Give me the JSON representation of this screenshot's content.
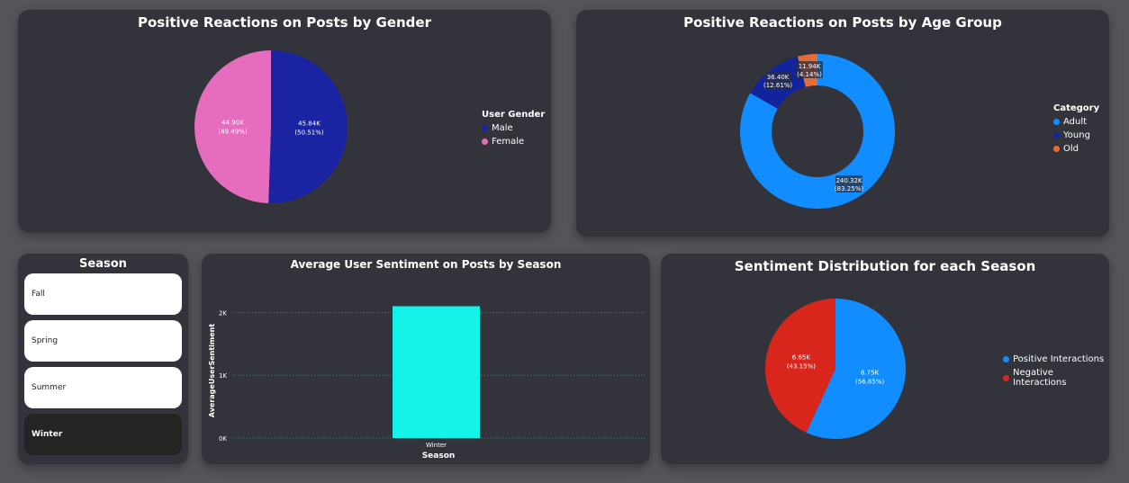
{
  "gender_card": {
    "title": "Positive Reactions on Posts by Gender",
    "legend_title": "User Gender"
  },
  "age_card": {
    "title": "Positive Reactions on Posts by Age Group",
    "legend_title": "Category"
  },
  "season_slicer": {
    "title": "Season",
    "items": [
      "Fall",
      "Spring",
      "Summer",
      "Winter"
    ],
    "selected": "Winter"
  },
  "bar_card": {
    "title": "Average User Sentiment on Posts by Season"
  },
  "season_pie_card": {
    "title": "Sentiment Distribution for each Season"
  },
  "chart_data": [
    {
      "type": "pie",
      "title": "Positive Reactions on Posts by Gender",
      "legend_title": "User Gender",
      "slices": [
        {
          "name": "Male",
          "value": 45.84,
          "unit": "K",
          "label": "45.84K",
          "pct_label": "(50.51%)",
          "color": "#1a24a3"
        },
        {
          "name": "Female",
          "value": 44.9,
          "unit": "K",
          "label": "44.90K",
          "pct_label": "(49.49%)",
          "color": "#e66cbd"
        }
      ]
    },
    {
      "type": "donut",
      "title": "Positive Reactions on Posts by Age Group",
      "legend_title": "Category",
      "slices": [
        {
          "name": "Adult",
          "value": 240.32,
          "unit": "K",
          "label": "240.32K",
          "pct_label": "(83.25%)",
          "color": "#118dff"
        },
        {
          "name": "Young",
          "value": 36.4,
          "unit": "K",
          "label": "36.40K",
          "pct_label": "(12.61%)",
          "color": "#12239e"
        },
        {
          "name": "Old",
          "value": 11.94,
          "unit": "K",
          "label": "11.94K",
          "pct_label": "(4.14%)",
          "color": "#e66c37"
        }
      ]
    },
    {
      "type": "bar",
      "title": "Average User Sentiment on Posts by Season",
      "xlabel": "Season",
      "ylabel": "AverageUserSentiment",
      "categories": [
        "Winter"
      ],
      "values": [
        2100
      ],
      "yticks": [
        0,
        1000,
        2000
      ],
      "ytick_labels": [
        "0K",
        "1K",
        "2K"
      ],
      "ylim": [
        0,
        2350
      ],
      "color": "#14f3e8",
      "grid": true
    },
    {
      "type": "pie",
      "title": "Sentiment Distribution for each Season",
      "slices": [
        {
          "name": "Positive Interactions",
          "value": 8.75,
          "unit": "K",
          "label": "8.75K",
          "pct_label": "(56.85%)",
          "color": "#118dff"
        },
        {
          "name": "Negative Interactions",
          "value": 6.65,
          "unit": "K",
          "label": "6.65K",
          "pct_label": "(43.15%)",
          "color": "#d9261c"
        }
      ]
    }
  ]
}
